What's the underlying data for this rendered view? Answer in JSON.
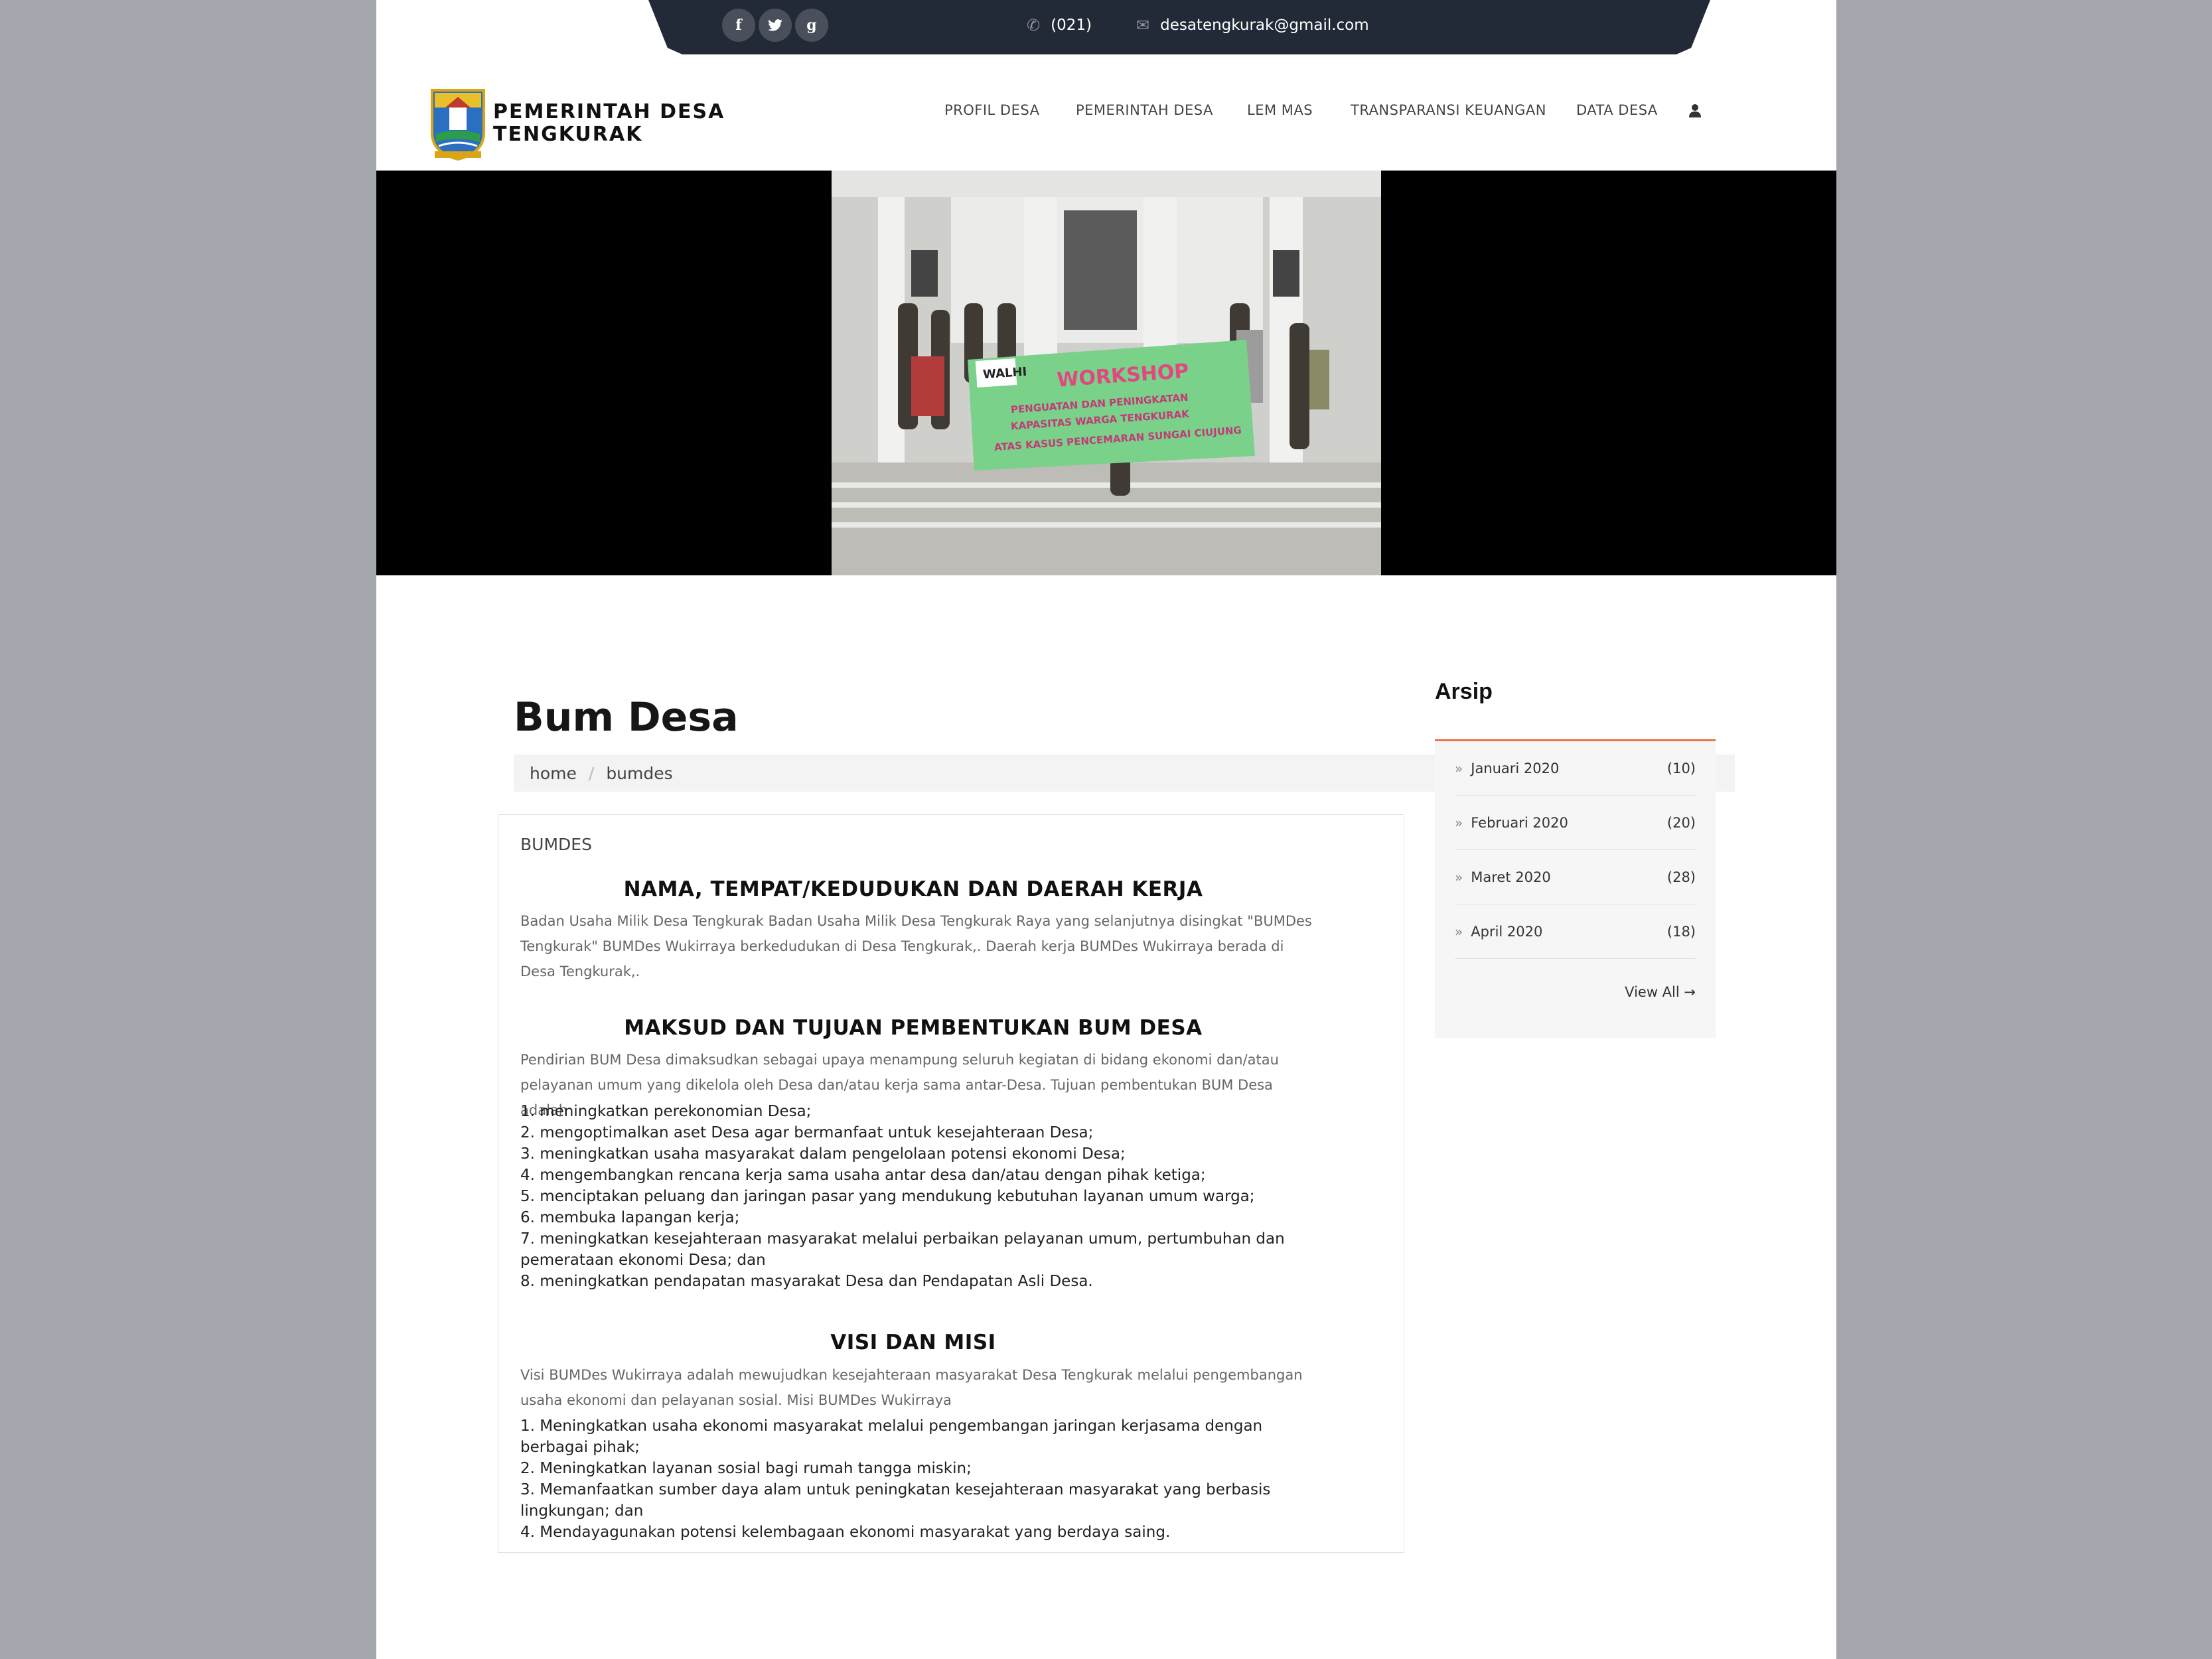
{
  "topbar": {
    "social": [
      {
        "name": "facebook-icon",
        "glyph": "f"
      },
      {
        "name": "twitter-icon",
        "glyph": "t"
      },
      {
        "name": "google-plus-icon",
        "glyph": "g"
      }
    ],
    "phone": "(021)",
    "email": "desatengkurak@gmail.com"
  },
  "header": {
    "brand_line1": "PEMERINTAH DESA",
    "brand_line2": "TENGKURAK",
    "nav": [
      "PROFIL DESA",
      "PEMERINTAH DESA",
      "LEM MAS",
      "TRANSPARANSI KEUANGAN",
      "DATA DESA"
    ]
  },
  "hero": {
    "banner_tag": "WALHI",
    "banner_title": "WORKSHOP",
    "banner_sub1": "PENGUATAN DAN PENINGKATAN",
    "banner_sub2": "KAPASITAS WARGA TENGKURAK",
    "banner_sub3": "ATAS KASUS PENCEMARAN SUNGAI CIUJUNG"
  },
  "page": {
    "title": "Bum Desa",
    "breadcrumb_home": "home",
    "breadcrumb_sep": "/",
    "breadcrumb_current": "bumdes"
  },
  "content": {
    "label": "BUMDES",
    "section1_title": "NAMA, TEMPAT/KEDUDUKAN DAN DAERAH KERJA",
    "section1_text": "Badan Usaha Milik Desa Tengkurak Badan Usaha Milik Desa Tengkurak Raya yang selanjutnya disingkat \"BUMDes Tengkurak\" BUMDes Wukirraya berkedudukan di Desa Tengkurak,. Daerah kerja BUMDes Wukirraya berada di Desa Tengkurak,.",
    "section2_title": "MAKSUD DAN TUJUAN PEMBENTUKAN BUM DESA",
    "section2_text": "Pendirian BUM Desa dimaksudkan sebagai upaya menampung seluruh kegiatan di bidang ekonomi dan/atau pelayanan umum yang dikelola oleh Desa dan/atau kerja sama antar-Desa. Tujuan pembentukan BUM Desa adalah",
    "section2_list": [
      "1. meningkatkan perekonomian Desa;",
      "2. mengoptimalkan aset Desa agar bermanfaat untuk kesejahteraan Desa;",
      "3. meningkatkan usaha masyarakat dalam pengelolaan potensi ekonomi Desa;",
      "4. mengembangkan rencana kerja sama usaha antar desa dan/atau dengan pihak ketiga;",
      "5. menciptakan peluang dan jaringan pasar yang mendukung kebutuhan layanan umum warga;",
      "6. membuka lapangan kerja;",
      "7. meningkatkan kesejahteraan masyarakat melalui perbaikan pelayanan umum, pertumbuhan dan pemerataan ekonomi Desa; dan",
      "8. meningkatkan pendapatan masyarakat Desa dan Pendapatan Asli Desa."
    ],
    "section3_title": "VISI DAN MISI",
    "section3_text": "Visi BUMDes Wukirraya adalah mewujudkan kesejahteraan masyarakat Desa Tengkurak melalui pengembangan usaha ekonomi dan pelayanan sosial. Misi BUMDes Wukirraya",
    "section3_list": [
      "1. Meningkatkan usaha ekonomi masyarakat melalui pengembangan jaringan kerjasama dengan berbagai pihak;",
      "2. Meningkatkan layanan sosial bagi rumah tangga miskin;",
      "3. Memanfaatkan sumber daya alam untuk peningkatan kesejahteraan masyarakat yang berbasis lingkungan; dan",
      "4. Mendayagunakan potensi kelembagaan ekonomi masyarakat yang berdaya saing."
    ]
  },
  "sidebar": {
    "title": "Arsip",
    "items": [
      {
        "label": "Januari 2020",
        "count": "(10)"
      },
      {
        "label": "Februari 2020",
        "count": "(20)"
      },
      {
        "label": "Maret 2020",
        "count": "(28)"
      },
      {
        "label": "April 2020",
        "count": "(18)"
      }
    ],
    "view_all": "View All →"
  },
  "colors": {
    "topbar": "#232a37",
    "accent": "#e87548",
    "banner_green": "#6ccf7a"
  }
}
